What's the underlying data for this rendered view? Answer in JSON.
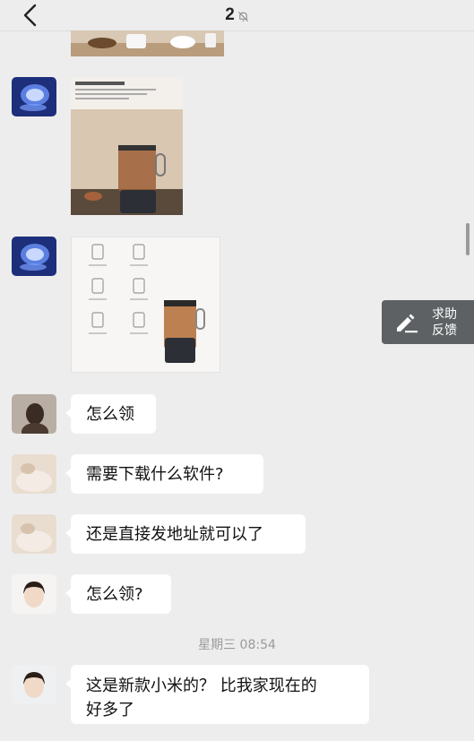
{
  "header": {
    "title": "2",
    "back_icon": "chevron-left-icon",
    "mute_icon": "bell-muted-icon"
  },
  "messages": {
    "m1": "怎么领",
    "m2": "需要下载什么软件?",
    "m3": "还是直接发地址就可以了",
    "m4": "怎么领?",
    "m5_line1": "这是新款小米的？ 比我家现在的",
    "m5_line2": "好多了"
  },
  "timestamp": "星期三 08:54",
  "feedback": {
    "line1": "求助",
    "line2": "反馈",
    "icon": "pencil-icon"
  },
  "colors": {
    "background": "#ededed",
    "bubble": "#ffffff",
    "feedback_bg": "#5d6163"
  }
}
